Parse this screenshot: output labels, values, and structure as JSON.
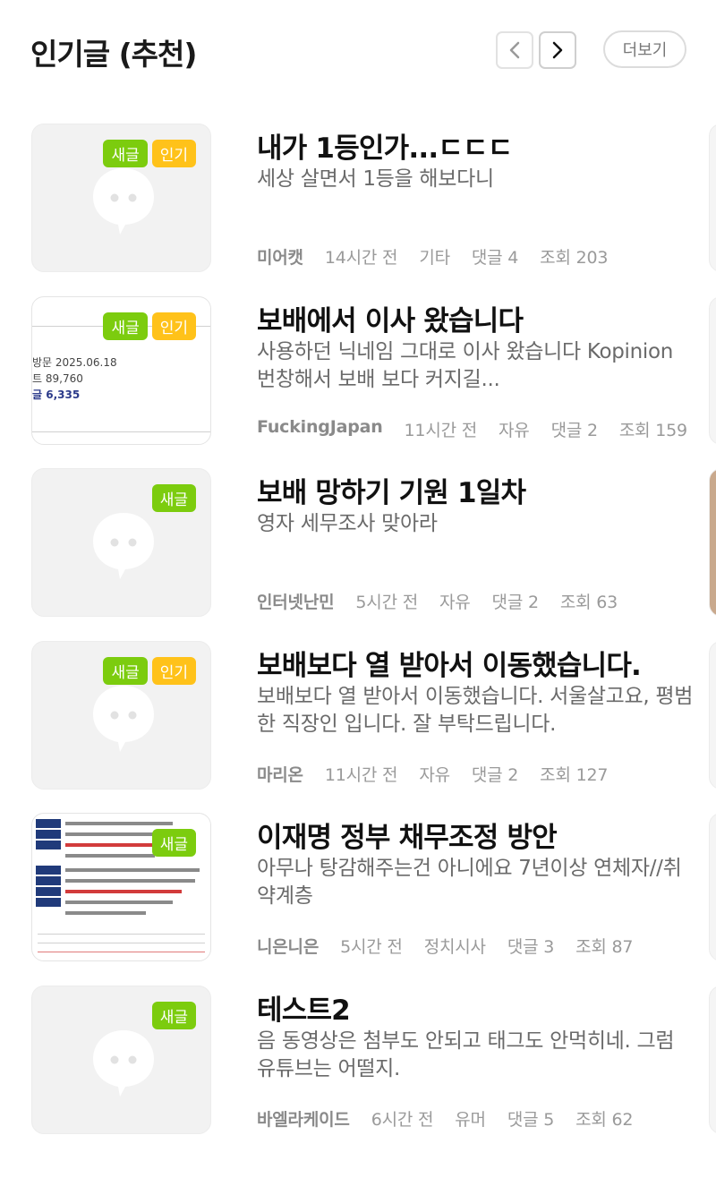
{
  "header": {
    "title": "인기글 (추천)",
    "prev_icon": "chevron-left-icon",
    "next_icon": "chevron-right-icon",
    "more_label": "더보기"
  },
  "colors": {
    "new_badge": "#7ccc0e",
    "hot_badge": "#ffc21a",
    "meta_text": "#9a9a9a"
  },
  "posts": [
    {
      "title": "내가 1등인가...ㄷㄷㄷ",
      "summary": "세상 살면서 1등을 해보다니",
      "author": "미어캣",
      "time": "14시간 전",
      "category": "기타",
      "comments": "댓글 4",
      "views": "조회 203",
      "badge_new": "새글",
      "badge_hot": "인기",
      "thumbnail": "placeholder-chat-icon"
    },
    {
      "title": "보배에서 이사 왔습니다",
      "summary": "사용하던 닉네임 그대로 이사 왔습니다 Kopinion 번창해서 보배 보다 커지길...",
      "author": "FuckingJapan",
      "time": "11시간 전",
      "category": "자유",
      "comments": "댓글 2",
      "views": "조회 159",
      "badge_new": "새글",
      "badge_hot": "인기",
      "thumbnail": "screenshot",
      "thumb_texts": [
        "방문 2025.06.18",
        "트 89,760",
        "글 6,335"
      ]
    },
    {
      "title": "보배 망하기 기원 1일차",
      "summary": "영자 세무조사 맞아라",
      "author": "인터넷난민",
      "time": "5시간 전",
      "category": "자유",
      "comments": "댓글 2",
      "views": "조회 63",
      "badge_new": "새글",
      "thumbnail": "placeholder-chat-icon"
    },
    {
      "title": "보배보다 열 받아서 이동했습니다.",
      "summary": "보배보다 열 받아서 이동했습니다. 서울살고요, 평범한 직장인 입니다. 잘 부탁드립니다.",
      "author": "마리온",
      "time": "11시간 전",
      "category": "자유",
      "comments": "댓글 2",
      "views": "조회 127",
      "badge_new": "새글",
      "badge_hot": "인기",
      "thumbnail": "placeholder-chat-icon"
    },
    {
      "title": "이재명 정부 채무조정 방안",
      "summary": "아무나 탕감해주는건 아니에요 7년이상 연체자//취약계층",
      "author": "니은니은",
      "time": "5시간 전",
      "category": "정치시사",
      "comments": "댓글 3",
      "views": "조회 87",
      "badge_new": "새글",
      "thumbnail": "document"
    },
    {
      "title": "테스트2",
      "summary": "음 동영상은 첨부도 안되고 태그도 안먹히네. 그럼 유튜브는 어떨지.",
      "author": "바엘라케이드",
      "time": "6시간 전",
      "category": "유머",
      "comments": "댓글 5",
      "views": "조회 62",
      "badge_new": "새글",
      "thumbnail": "placeholder-chat-icon"
    }
  ]
}
